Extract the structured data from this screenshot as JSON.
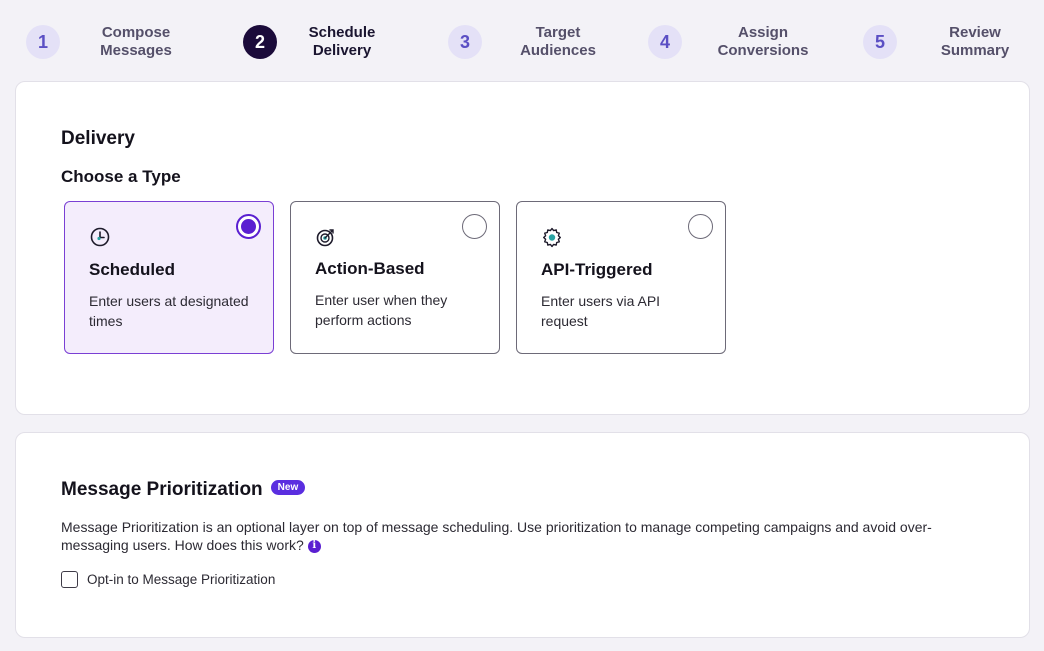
{
  "stepper": {
    "steps": [
      {
        "number": "1",
        "label_line1": "Compose",
        "label_line2": "Messages",
        "active": false
      },
      {
        "number": "2",
        "label_line1": "Schedule",
        "label_line2": "Delivery",
        "active": true
      },
      {
        "number": "3",
        "label_line1": "Target",
        "label_line2": "Audiences",
        "active": false
      },
      {
        "number": "4",
        "label_line1": "Assign",
        "label_line2": "Conversions",
        "active": false
      },
      {
        "number": "5",
        "label_line1": "Review",
        "label_line2": "Summary",
        "active": false
      }
    ]
  },
  "delivery": {
    "title": "Delivery",
    "choose_label": "Choose a Type",
    "types": [
      {
        "name": "Scheduled",
        "description": "Enter users at designated times",
        "icon": "clock-icon",
        "selected": true
      },
      {
        "name": "Action-Based",
        "description": "Enter user when they perform actions",
        "icon": "target-icon",
        "selected": false
      },
      {
        "name": "API-Triggered",
        "description": "Enter users via API request",
        "icon": "gear-icon",
        "selected": false
      }
    ]
  },
  "prioritization": {
    "title": "Message Prioritization",
    "badge": "New",
    "description": "Message Prioritization is an optional layer on top of message scheduling. Use prioritization to manage competing campaigns and avoid over-messaging users. How does this work?",
    "info_icon": "info-icon",
    "optin_label": "Opt-in to Message Prioritization",
    "optin_checked": false
  },
  "colors": {
    "accent": "#5a1fd1",
    "selected_bg": "#f4edfc",
    "active_step": "#1b0b3a",
    "inactive_step_bg": "#e4e1f7"
  }
}
